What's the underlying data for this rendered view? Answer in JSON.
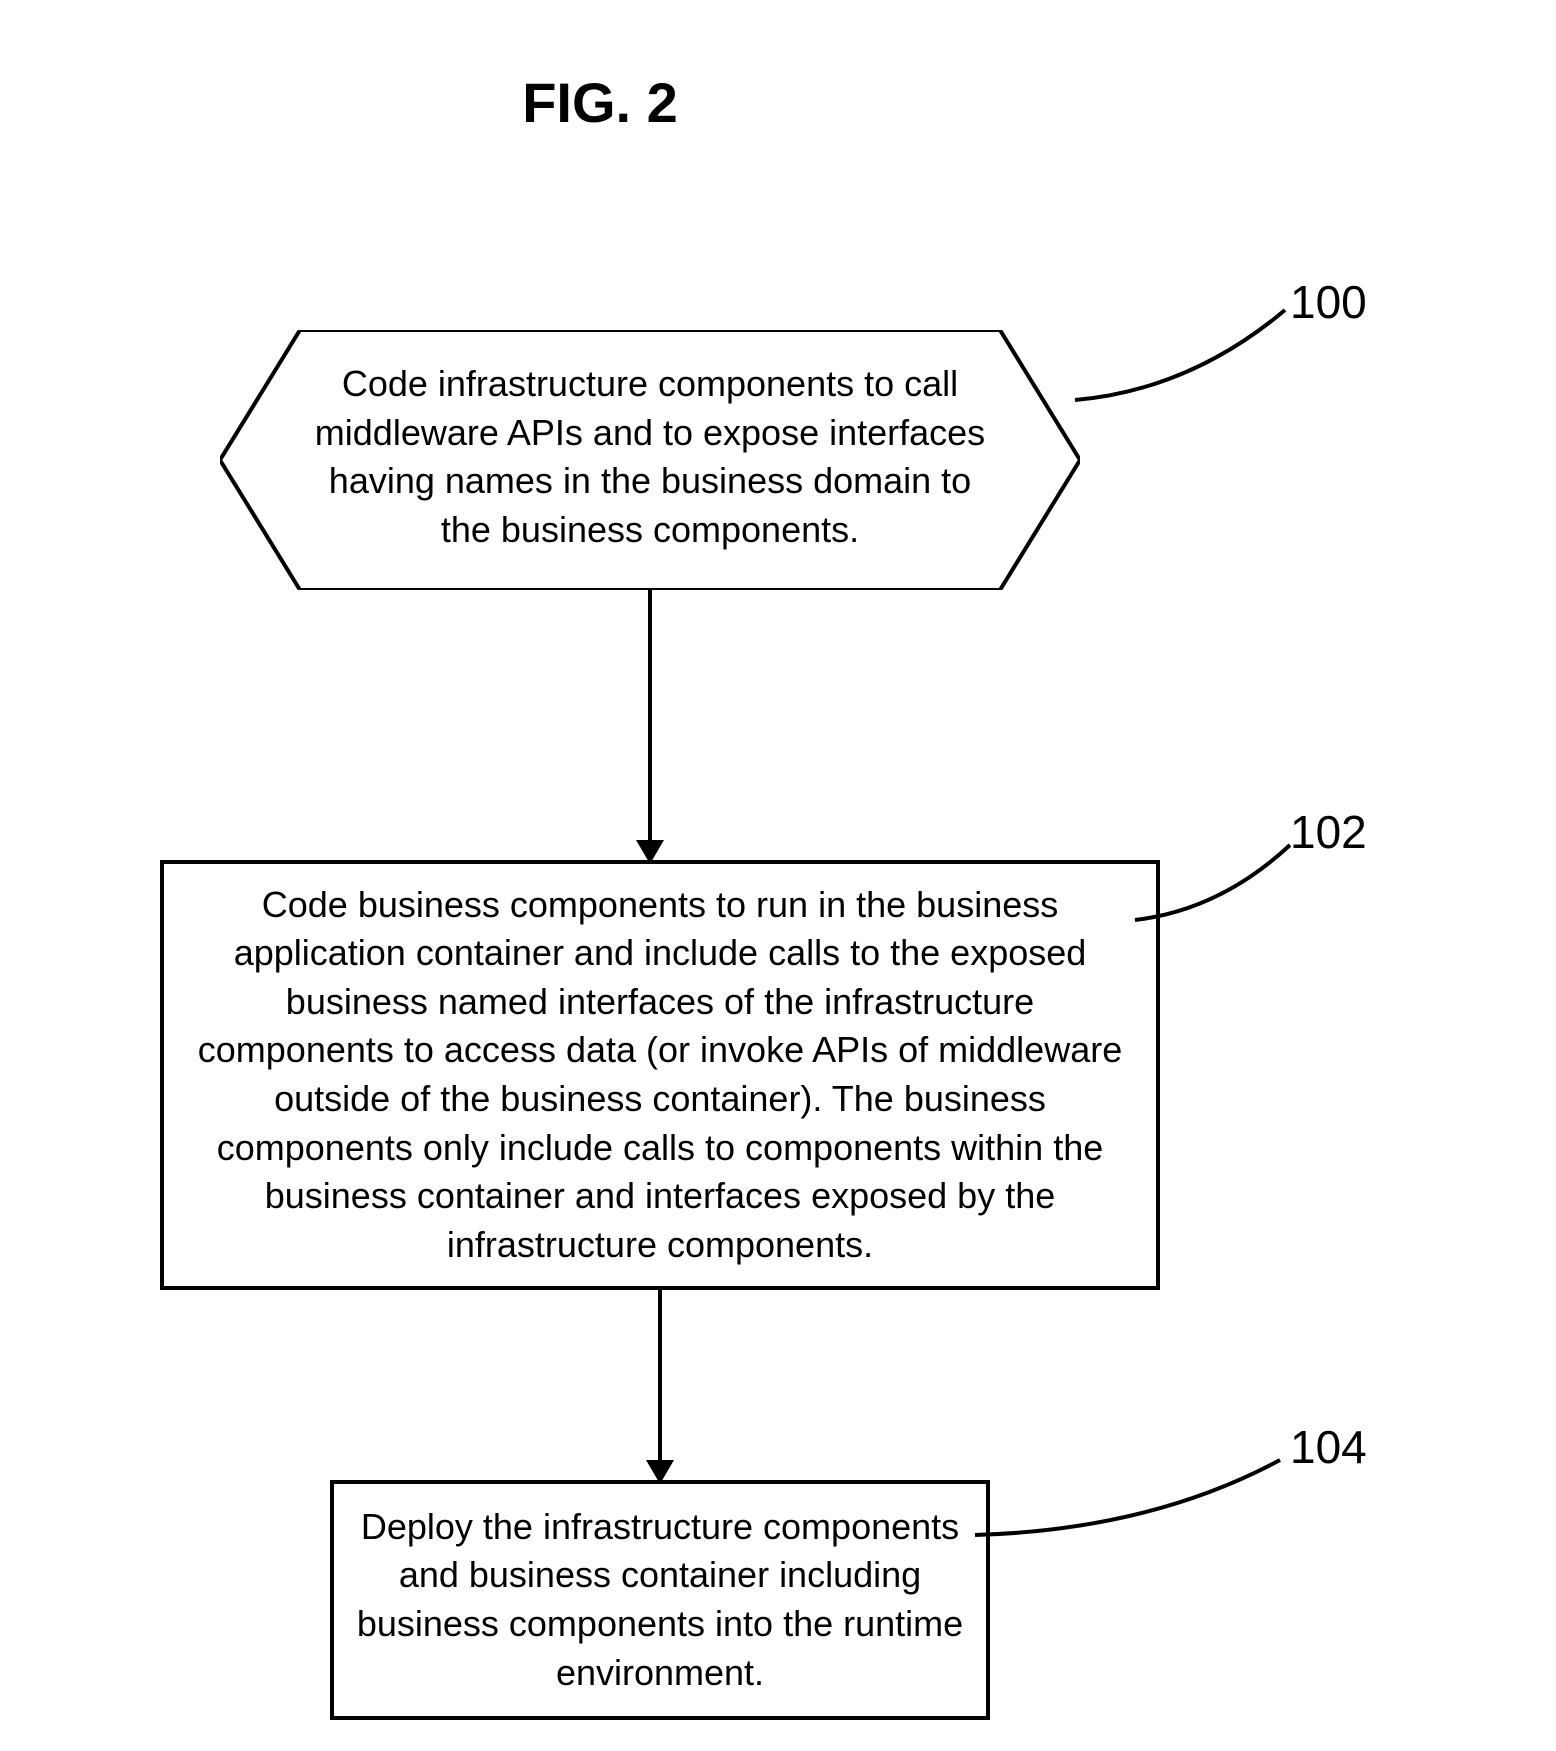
{
  "figure_title": "FIG. 2",
  "steps": {
    "s100": {
      "ref": "100",
      "text": "Code infrastructure components to call middleware APIs and to expose interfaces having names in the business domain to the business components."
    },
    "s102": {
      "ref": "102",
      "text": "Code business components to run in the business application container and include calls to the exposed business named interfaces of the infrastructure components to access data (or invoke APIs of middleware outside of the business container).  The business components only include calls to components within the business container and interfaces exposed by the infrastructure components."
    },
    "s104": {
      "ref": "104",
      "text": "Deploy the infrastructure components and business container including business components into the runtime environment."
    }
  }
}
